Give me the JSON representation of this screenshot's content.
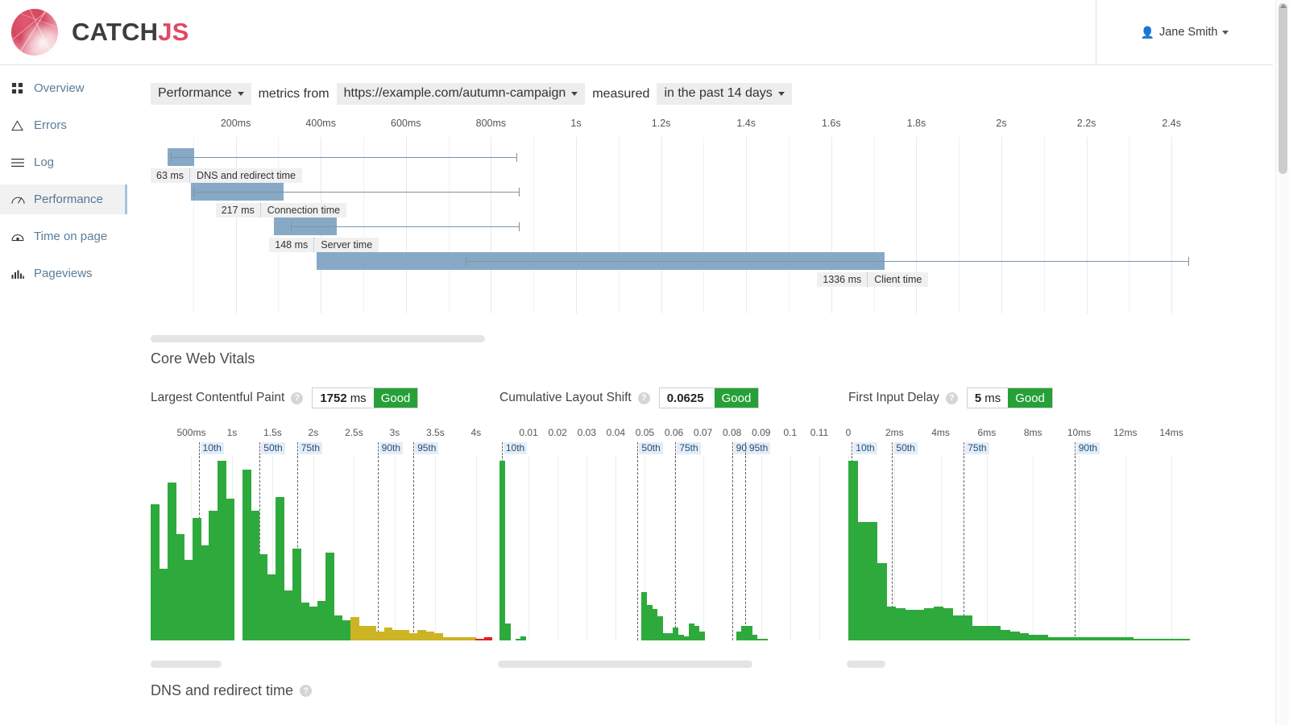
{
  "header": {
    "brand_first": "CATCH",
    "brand_second": "JS",
    "user_name": "Jane Smith",
    "user_icon": "person-icon",
    "caret_icon": "caret-down-icon"
  },
  "sidebar": {
    "items": [
      {
        "label": "Overview",
        "icon": "grid-icon",
        "active": false
      },
      {
        "label": "Errors",
        "icon": "triangle-warning-icon",
        "active": false
      },
      {
        "label": "Log",
        "icon": "list-lines-icon",
        "active": false
      },
      {
        "label": "Performance",
        "icon": "speedometer-icon",
        "active": true
      },
      {
        "label": "Time on page",
        "icon": "clock-gauge-icon",
        "active": false
      },
      {
        "label": "Pageviews",
        "icon": "bar-chart-icon",
        "active": false
      }
    ]
  },
  "filter_bar": {
    "metric_type": "Performance",
    "text_1": "metrics from",
    "url": "https://example.com/autumn-campaign",
    "text_2": "measured",
    "period": "in the past 14 days"
  },
  "sections": {
    "core_web_vitals_title": "Core Web Vitals",
    "dns_redirect_title": "DNS and redirect time",
    "help_glyph": "?"
  },
  "vitals": [
    {
      "name": "Largest Contentful Paint",
      "value": "1752",
      "unit": "ms",
      "rating": "Good",
      "rating_color": "#26a037"
    },
    {
      "name": "Cumulative Layout Shift",
      "value": "0.0625",
      "unit": "",
      "rating": "Good",
      "rating_color": "#26a037"
    },
    {
      "name": "First Input Delay",
      "value": "5",
      "unit": "ms",
      "rating": "Good",
      "rating_color": "#26a037"
    }
  ],
  "chart_data": [
    {
      "type": "bar",
      "name": "navigation-timing-waterfall",
      "title": "",
      "orientation": "horizontal",
      "xlabel": "",
      "ylabel": "",
      "xlim": [
        0,
        2500
      ],
      "x_unit": "ms",
      "grid": true,
      "tick_labels": [
        "200ms",
        "400ms",
        "600ms",
        "800ms",
        "1s",
        "1.2s",
        "1.4s",
        "1.6s",
        "1.8s",
        "2s",
        "2.2s",
        "2.4s"
      ],
      "tick_values": [
        200,
        400,
        600,
        800,
        1000,
        1200,
        1400,
        1600,
        1800,
        2000,
        2200,
        2400
      ],
      "bar_color": "#87a9c6",
      "rows": [
        {
          "label": "DNS and redirect time",
          "value": "63 ms",
          "start": 40,
          "end": 103,
          "whisker_start": 47,
          "whisker_end": 860
        },
        {
          "label": "Connection time",
          "value": "217 ms",
          "start": 95,
          "end": 312,
          "whisker_start": 100,
          "whisker_end": 865
        },
        {
          "label": "Server time",
          "value": "148 ms",
          "start": 290,
          "end": 438,
          "whisker_start": 330,
          "whisker_end": 865
        },
        {
          "label": "Client time",
          "value": "1336 ms",
          "start": 390,
          "end": 1726,
          "whisker_start": 740,
          "whisker_end": 2440
        }
      ]
    },
    {
      "type": "bar",
      "name": "lcp-histogram",
      "title": "Largest Contentful Paint",
      "xlabel": "",
      "ylabel": "",
      "xlim": [
        0,
        4200
      ],
      "x_unit": "ms",
      "tick_labels": [
        "500ms",
        "1s",
        "1.5s",
        "2s",
        "2.5s",
        "3s",
        "3.5s",
        "4s"
      ],
      "tick_values": [
        500,
        1000,
        1500,
        2000,
        2500,
        3000,
        3500,
        4000
      ],
      "percentiles": [
        {
          "label": "10th",
          "x": 590
        },
        {
          "label": "50th",
          "x": 1340
        },
        {
          "label": "75th",
          "x": 1800
        },
        {
          "label": "90th",
          "x": 2790
        },
        {
          "label": "95th",
          "x": 3230
        }
      ],
      "colors": {
        "good": "#2eaa3d",
        "needs_improvement": "#cdb425",
        "poor": "#e02020"
      },
      "thresholds": {
        "good_max": 2500,
        "ni_max": 4000
      },
      "values": [
        76,
        40,
        88,
        59,
        45,
        68,
        53,
        72,
        100,
        79,
        0,
        95,
        72,
        48,
        37,
        80,
        28,
        51,
        21,
        19,
        22,
        49,
        14,
        11,
        13,
        8,
        8,
        5,
        7,
        6,
        6,
        4,
        6,
        5,
        4,
        2,
        2,
        2,
        2,
        1,
        2
      ]
    },
    {
      "type": "bar",
      "name": "cls-histogram",
      "title": "Cumulative Layout Shift",
      "xlabel": "",
      "ylabel": "",
      "xlim": [
        0,
        0.1175
      ],
      "x_unit": "",
      "tick_labels": [
        "0.01",
        "0.02",
        "0.03",
        "0.04",
        "0.05",
        "0.06",
        "0.07",
        "0.08",
        "0.09",
        "0.1",
        "0.11"
      ],
      "tick_values": [
        0.01,
        0.02,
        0.03,
        0.04,
        0.05,
        0.06,
        0.07,
        0.08,
        0.09,
        0.1,
        0.11
      ],
      "percentiles": [
        {
          "label": "10th",
          "x": 0.0008
        },
        {
          "label": "50th",
          "x": 0.0475
        },
        {
          "label": "75th",
          "x": 0.0605
        },
        {
          "label": "90th",
          "x": 0.08
        },
        {
          "label": "95th",
          "x": 0.0845
        }
      ],
      "colors": {
        "good": "#2eaa3d",
        "needs_improvement": "#cdb425",
        "poor": "#e02020"
      },
      "thresholds": {
        "good_max": 0.1,
        "ni_max": 0.25
      },
      "values": [
        97,
        9,
        0,
        1,
        2,
        0,
        0,
        0,
        0,
        0,
        0,
        0,
        0,
        0,
        0,
        0,
        0,
        0,
        0,
        0,
        0,
        0,
        0,
        0,
        0,
        0,
        0,
        26,
        19,
        17,
        13,
        4,
        4,
        7,
        3,
        2,
        9,
        8,
        5,
        0,
        0,
        0,
        0,
        0,
        0,
        5,
        8,
        8,
        3,
        1,
        1,
        0,
        0,
        0,
        0,
        0,
        0,
        0,
        0,
        0,
        0,
        0,
        0,
        0,
        0
      ]
    },
    {
      "type": "bar",
      "name": "fid-histogram",
      "title": "First Input Delay",
      "xlabel": "",
      "ylabel": "",
      "xlim": [
        0,
        14.8
      ],
      "x_unit": "ms",
      "tick_labels": [
        "0",
        "2ms",
        "4ms",
        "6ms",
        "8ms",
        "10ms",
        "12ms",
        "14ms"
      ],
      "tick_values": [
        0,
        2,
        4,
        6,
        8,
        10,
        12,
        14
      ],
      "percentiles": [
        {
          "label": "10th",
          "x": 0.15
        },
        {
          "label": "50th",
          "x": 1.9
        },
        {
          "label": "75th",
          "x": 5.0
        },
        {
          "label": "90th",
          "x": 9.8
        }
      ],
      "colors": {
        "good": "#2eaa3d",
        "needs_improvement": "#cdb425",
        "poor": "#e02020"
      },
      "thresholds": {
        "good_max": 100,
        "ni_max": 300
      },
      "values": [
        100,
        66,
        66,
        43,
        19,
        18,
        17,
        17,
        18,
        19,
        18,
        14,
        14,
        8,
        8,
        8,
        6,
        5,
        4,
        3,
        3,
        2,
        2,
        2,
        2,
        2,
        2,
        2,
        2,
        2,
        1,
        1,
        1,
        1,
        1,
        1
      ]
    }
  ],
  "scrollbars": {
    "waterfall_thumb": "horizontal-scrollbar-thumb",
    "lcp_thumb": "horizontal-scrollbar-thumb",
    "cls_thumb": "horizontal-scrollbar-thumb",
    "fid_thumb": "horizontal-scrollbar-thumb",
    "page_thumb": "vertical-scrollbar-thumb"
  }
}
